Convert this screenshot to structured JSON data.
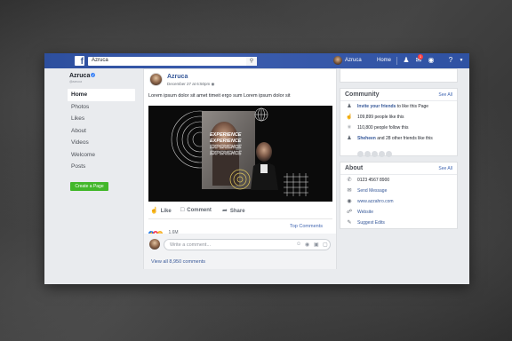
{
  "topbar": {
    "search_value": "Azruca",
    "username": "Azruca",
    "home_label": "Home",
    "notification_count": "1"
  },
  "page": {
    "name": "Azruca",
    "handle": "@azruca"
  },
  "left_nav": {
    "items": [
      {
        "label": "Home"
      },
      {
        "label": "Photos"
      },
      {
        "label": "Likes"
      },
      {
        "label": "About"
      },
      {
        "label": "Videos"
      },
      {
        "label": "Welcome"
      },
      {
        "label": "Posts"
      }
    ],
    "create_page_label": "Create a Page"
  },
  "post": {
    "author": "Azruca",
    "date": "December 27 at 6:50pm",
    "text": "Lorem ipsum dolor sit amet timeit ergo sum Lorem ipsum dolor sit",
    "image_overlay_words": [
      "EXPERIENCE",
      "EXPERIENCE",
      "EXPERIENCE",
      "EXPERIENCE"
    ],
    "actions": {
      "like": "Like",
      "comment": "Comment",
      "share": "Share"
    },
    "reaction_count": "1.6M",
    "top_comments_label": "Top Comments",
    "comment_placeholder": "Write a comment...",
    "view_all_comments": "View all 8,950 comments"
  },
  "community": {
    "title": "Community",
    "see_all": "See All",
    "invite_link": "Invite your friends",
    "invite_rest": " to like this Page",
    "likes": "109,899 people like this",
    "follows": "110,800 people follow this",
    "friends_name": "Sheheen",
    "friends_rest": " and 28 other friends like this"
  },
  "about": {
    "title": "About",
    "see_all": "See All",
    "phone": "0123 4567 8900",
    "send_message": "Send Message",
    "website_url": "www.azzahro.com",
    "website_label": "Website",
    "suggest_edits": "Suggest Edits"
  },
  "colors": {
    "brand_blue": "#3b5998",
    "link_blue": "#365899",
    "create_green": "#42b72a",
    "badge_red": "#fa3e3e"
  },
  "icons": [
    "facebook-logo-icon",
    "search-icon",
    "friends-icon",
    "messenger-icon",
    "globe-icon",
    "help-icon",
    "caret-down-icon",
    "verified-icon",
    "like-icon",
    "comment-icon",
    "share-icon",
    "camera-icon",
    "emoji-icon",
    "gif-icon",
    "sticker-icon",
    "phone-icon",
    "messenger-icon",
    "globe-icon",
    "pencil-icon"
  ]
}
